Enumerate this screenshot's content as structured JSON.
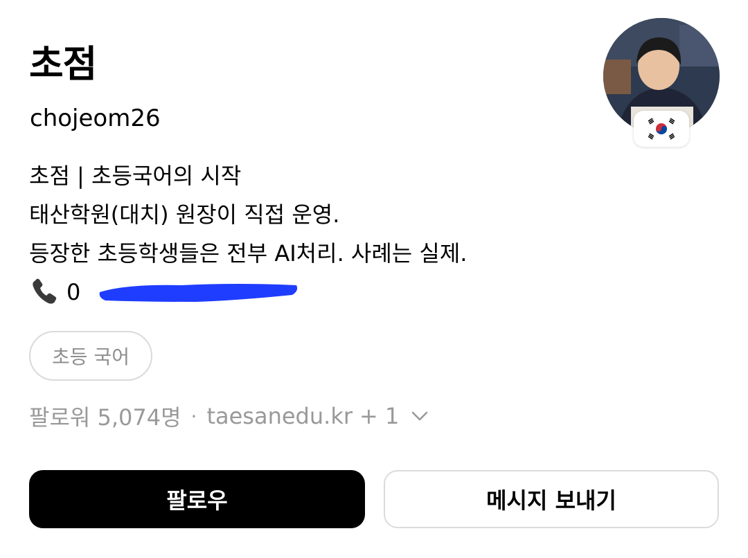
{
  "profile": {
    "display_name": "초점",
    "username": "chojeom26",
    "bio": [
      "초점 | 초등국어의 시작",
      "태산학원(대치) 원장이 직접 운영.",
      "등장한 초등학생들은 전부 AI처리. 사례는 실제."
    ],
    "phone_prefix": "0"
  },
  "tag": {
    "label": "초등 국어"
  },
  "meta": {
    "followers": "팔로워 5,074명",
    "separator": "·",
    "link": "taesanedu.kr",
    "extra_links": "+ 1"
  },
  "actions": {
    "follow_label": "팔로우",
    "message_label": "메시지 보내기"
  },
  "icons": {
    "phone": "phone-icon",
    "flag": "south-korea-flag-icon",
    "chevron": "chevron-down-icon"
  },
  "colors": {
    "primary_button": "#000000",
    "muted_text": "#999999",
    "redaction": "#1f3dff"
  }
}
